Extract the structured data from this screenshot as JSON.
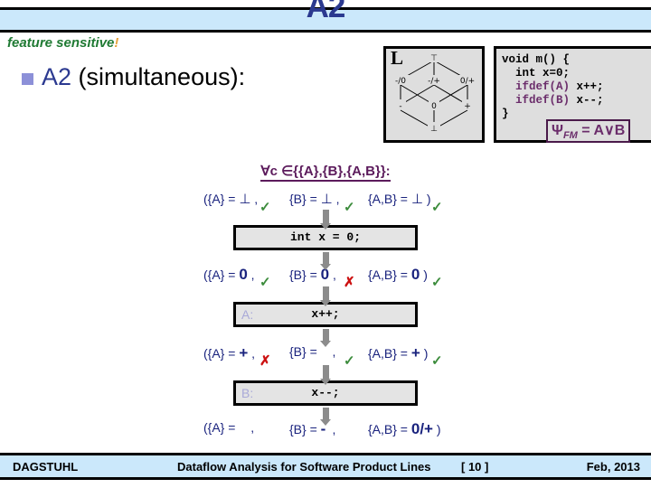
{
  "header": {
    "title": "A2",
    "note": "feature sensitive",
    "note_bang": "!"
  },
  "bullet": {
    "a2_label": "A2",
    "rest_label": " (simultaneous):"
  },
  "lattice": {
    "label": "L",
    "nodes": {
      "top": "⊤",
      "minus_zero": "-/0",
      "minus_plus": "-/+",
      "zero_plus": "0/+",
      "minus": "-",
      "zero": "0",
      "plus": "+",
      "bottom": "⊥"
    }
  },
  "code": {
    "line1": "void m() {",
    "line2": "int x=0;",
    "line3a": "ifdef(A)",
    "line3b": "x++;",
    "line4a": "ifdef(B)",
    "line4b": "x--;",
    "line5": "}",
    "formula_lhs": "Ψ",
    "formula_sub": "FM",
    "formula_rhs": " = A∨B"
  },
  "forall": {
    "text": "∀c ∈{{A},{B},{A,B}}:"
  },
  "rows": [
    {
      "cells": [
        {
          "label": "({A} = ",
          "value": "⊥",
          "symbol": true,
          "mark": "check"
        },
        {
          "label": "{B} = ",
          "value": "⊥",
          "symbol": true,
          "mark": "check"
        },
        {
          "label": "{A,B} = ",
          "value": "⊥",
          "symbol": true,
          "mark": "check",
          "close": " )"
        }
      ]
    },
    {
      "cells": [
        {
          "label": "({A} = ",
          "value": "0",
          "symbol": false,
          "mark": "check"
        },
        {
          "label": "{B} = ",
          "value": "0",
          "symbol": false,
          "mark": "cross"
        },
        {
          "label": "{A,B} = ",
          "value": "0",
          "symbol": false,
          "mark": "check",
          "close": " )"
        }
      ]
    },
    {
      "cells": [
        {
          "label": "({A} = ",
          "value": "+",
          "symbol": false,
          "mark": "cross"
        },
        {
          "label": "{B} = ",
          "value": "",
          "symbol": false,
          "mark": "check"
        },
        {
          "label": "{A,B} = ",
          "value": "+",
          "symbol": false,
          "mark": "check",
          "close": " )"
        }
      ]
    },
    {
      "cells": [
        {
          "label": "({A} = ",
          "value": "",
          "symbol": false,
          "mark": ""
        },
        {
          "label": "{B} = ",
          "value": "-",
          "symbol": false,
          "mark": ""
        },
        {
          "label": "{A,B} = ",
          "value": "0/+",
          "symbol": false,
          "mark": "",
          "close": " )"
        }
      ]
    }
  ],
  "statements": [
    {
      "feature": "",
      "code": "int x = 0;"
    },
    {
      "feature": "A:",
      "code": "x++;"
    },
    {
      "feature": "B:",
      "code": "x--;"
    }
  ],
  "footer": {
    "left": "DAGSTUHL",
    "center": "Dataflow Analysis for Software Product Lines",
    "page": "[ 10 ]",
    "right": "Feb, 2013"
  },
  "colors": {
    "band": "#cbe8fb",
    "title": "#2b3990",
    "note": "#1f7a33",
    "purple": "#5c1b5c",
    "value_blue": "#1a237e",
    "check_green": "#3c8c3c",
    "cross_red": "#cc1111",
    "arrow_gray": "#8c8c8c"
  }
}
